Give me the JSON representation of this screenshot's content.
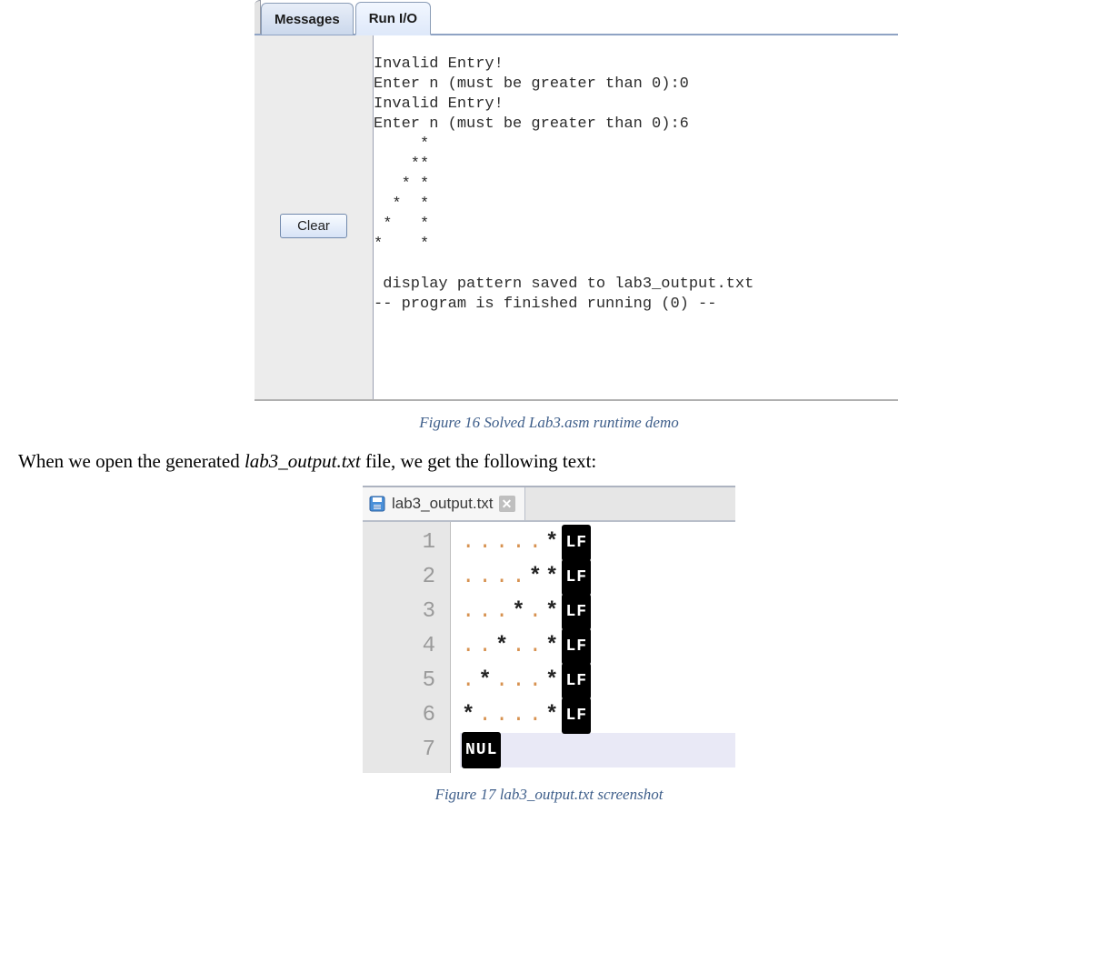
{
  "mars": {
    "tabs": {
      "messages": "Messages",
      "runio": "Run I/O"
    },
    "clear_label": "Clear",
    "console_text": "Invalid Entry!\nEnter n (must be greater than 0):0\nInvalid Entry!\nEnter n (must be greater than 0):6\n     *\n    **\n   * *\n  *  *\n *   *\n*    *\n\n display pattern saved to lab3_output.txt\n-- program is finished running (0) --"
  },
  "caption_fig16": "Figure 16 Solved Lab3.asm runtime demo",
  "paragraph": {
    "before": "When we open the generated ",
    "filename": "lab3_output.txt",
    "after": " file, we get the following text:"
  },
  "editor": {
    "tab_filename": "lab3_output.txt",
    "close_glyph": "✕",
    "lines": [
      {
        "num": "1",
        "pattern": ".....*",
        "suffix": "LF"
      },
      {
        "num": "2",
        "pattern": "....**",
        "suffix": "LF"
      },
      {
        "num": "3",
        "pattern": "...*.*",
        "suffix": "LF"
      },
      {
        "num": "4",
        "pattern": "..*..*",
        "suffix": "LF"
      },
      {
        "num": "5",
        "pattern": ".*...*",
        "suffix": "LF"
      },
      {
        "num": "6",
        "pattern": "*....*",
        "suffix": "LF"
      },
      {
        "num": "7",
        "pattern": "",
        "suffix": "NUL"
      }
    ]
  },
  "caption_fig17": "Figure 17 lab3_output.txt screenshot"
}
